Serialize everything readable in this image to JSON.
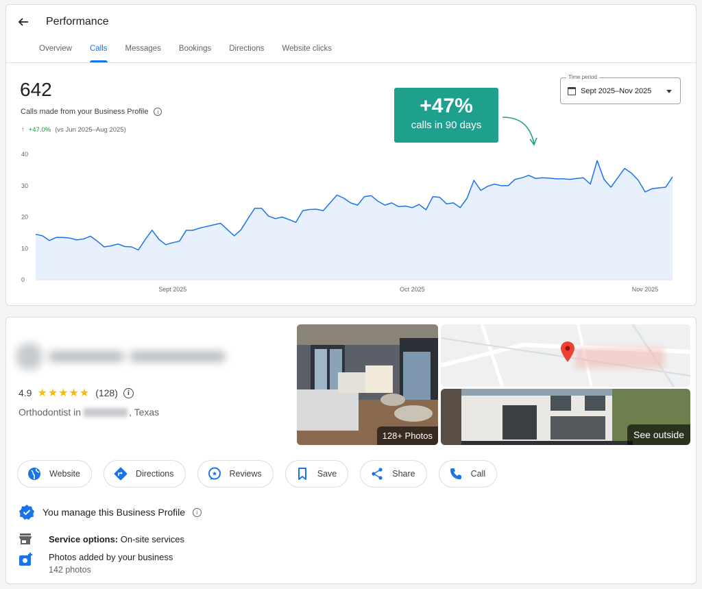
{
  "header": {
    "back_icon": "arrow-left-icon",
    "title": "Performance"
  },
  "tabs": [
    {
      "label": "Overview",
      "active": false
    },
    {
      "label": "Calls",
      "active": true
    },
    {
      "label": "Messages",
      "active": false
    },
    {
      "label": "Bookings",
      "active": false
    },
    {
      "label": "Directions",
      "active": false
    },
    {
      "label": "Website clicks",
      "active": false
    }
  ],
  "summary": {
    "total": "642",
    "label": "Calls made from your Business Profile",
    "change": "+47.0%",
    "comparison": "(vs Jun 2025–Aug 2025)"
  },
  "time_period": {
    "label": "Time period",
    "value": "Sept 2025–Nov 2025"
  },
  "callout": {
    "value": "+47%",
    "caption": "calls in 90 days",
    "color": "#1fa08e"
  },
  "chart_data": {
    "type": "area",
    "ylim": [
      0,
      40
    ],
    "yticks": [
      0,
      10,
      20,
      30,
      40
    ],
    "xtick_labels": [
      {
        "label": "Sept 2025",
        "index": 20
      },
      {
        "label": "Oct 2025",
        "index": 55
      },
      {
        "label": "Nov 2025",
        "index": 89
      }
    ],
    "values": [
      14.5,
      14,
      12.5,
      13.5,
      13.5,
      13.3,
      12.7,
      13,
      13.9,
      12.3,
      10.5,
      10.8,
      11.4,
      10.6,
      10.5,
      9.5,
      12.8,
      15.8,
      12.9,
      11.2,
      11.8,
      12.3,
      15.8,
      15.8,
      16.5,
      17,
      17.5,
      18,
      16,
      14,
      16,
      19.5,
      22.8,
      22.8,
      20.3,
      19.5,
      20,
      19.2,
      18.3,
      22,
      22.4,
      22.5,
      22,
      24.5,
      27,
      26,
      24.5,
      23.8,
      26.5,
      26.8,
      25,
      23.8,
      24.5,
      23.3,
      23.5,
      23,
      24,
      22.3,
      26.5,
      26.3,
      24.2,
      24.5,
      23,
      26,
      31.7,
      28.5,
      29.8,
      30.5,
      30,
      30,
      32,
      32.5,
      33.3,
      32.3,
      32.5,
      32.4,
      32.2,
      32.2,
      32,
      32.3,
      32.5,
      30.5,
      38,
      32,
      29.5,
      32.5,
      35.5,
      34,
      31.7,
      28,
      29,
      29.3,
      29.5,
      32.8
    ],
    "line_color": "#1a73e8",
    "fill_color": "#e8f0fe",
    "grid": false
  },
  "business": {
    "rating": "4.9",
    "stars": "★★★★★",
    "review_count": "(128)",
    "category_prefix": "Orthodontist in",
    "category_suffix": ", Texas",
    "photos_label": "128+ Photos",
    "outside_label": "See outside",
    "actions": [
      {
        "label": "Website",
        "icon": "globe-icon"
      },
      {
        "label": "Directions",
        "icon": "directions-icon"
      },
      {
        "label": "Reviews",
        "icon": "reviews-icon"
      },
      {
        "label": "Save",
        "icon": "bookmark-icon"
      },
      {
        "label": "Share",
        "icon": "share-icon"
      },
      {
        "label": "Call",
        "icon": "phone-icon"
      }
    ],
    "manage_text": "You manage this Business Profile",
    "service_label": "Service options:",
    "service_value": "On-site services",
    "photos_added_title": "Photos added by your business",
    "photos_added_count": "142 photos"
  }
}
